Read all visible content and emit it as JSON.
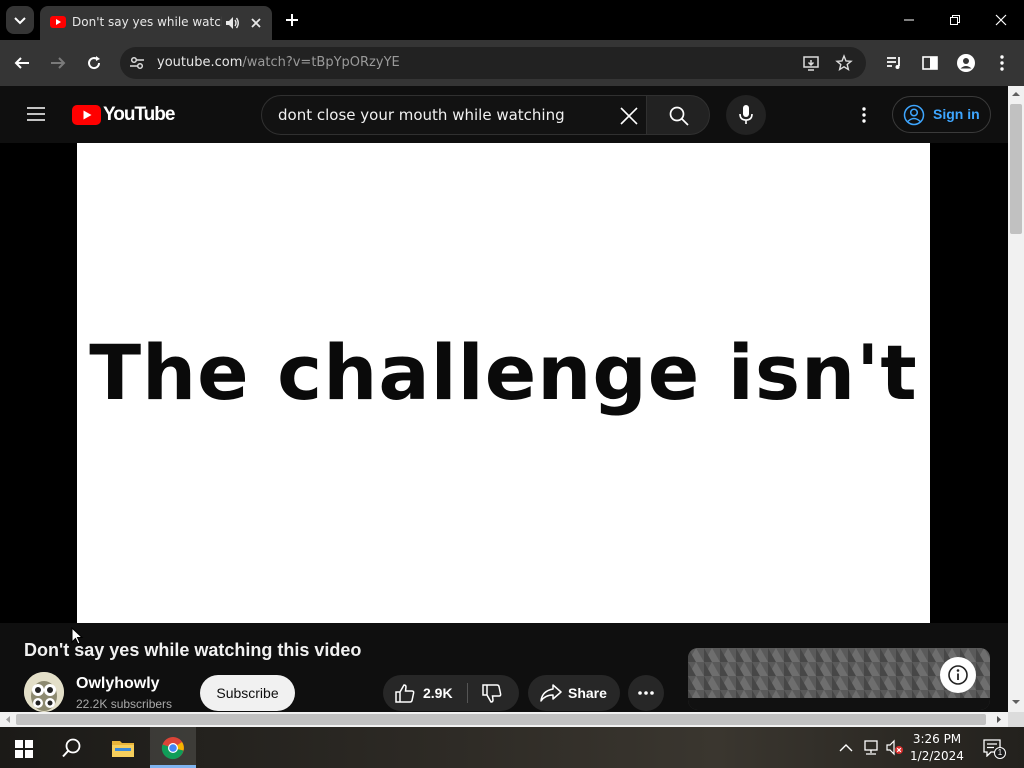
{
  "browser": {
    "tab_title": "Don't say yes while watching this video",
    "url_host": "youtube.com",
    "url_path": "/watch?v=tBpYpORzyYE"
  },
  "youtube": {
    "logo_text": "YouTube",
    "search_query": "dont close your mouth while watching",
    "sign_in_label": "Sign in"
  },
  "video": {
    "caption_text": "The challenge isn't",
    "title": "Don't say yes while watching this video",
    "channel_name": "Owlyhowly",
    "subscribers": "22.2K subscribers",
    "subscribe_label": "Subscribe",
    "likes": "2.9K",
    "share_label": "Share"
  },
  "taskbar": {
    "time": "3:26 PM",
    "date": "1/2/2024",
    "notification_count": "1"
  },
  "colors": {
    "youtube_red": "#ff0000",
    "link_blue": "#3ea6ff",
    "chrome_toolbar": "#353535"
  }
}
